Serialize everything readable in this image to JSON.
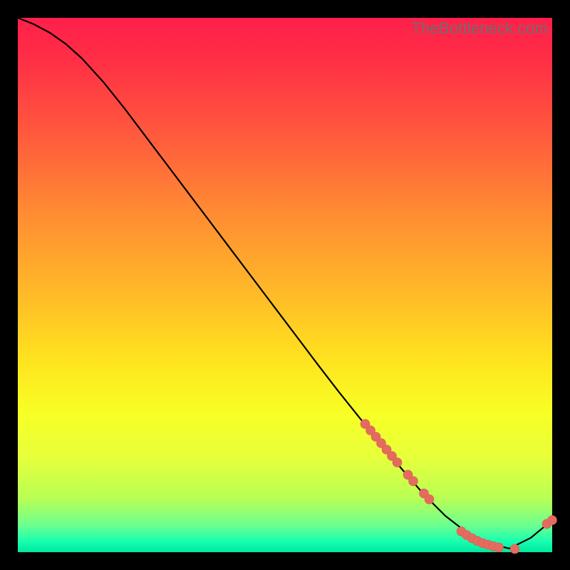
{
  "attribution": "TheBottleneck.com",
  "chart_data": {
    "type": "line",
    "title": "",
    "xlabel": "",
    "ylabel": "",
    "xlim": [
      0,
      100
    ],
    "ylim": [
      0,
      100
    ],
    "grid": false,
    "legend": false,
    "series": [
      {
        "name": "bottleneck-curve",
        "x": [
          0,
          3,
          6,
          9,
          12,
          16,
          20,
          24,
          28,
          32,
          36,
          40,
          44,
          48,
          52,
          56,
          60,
          64,
          68,
          72,
          76,
          80,
          84,
          88,
          92,
          96,
          100
        ],
        "y": [
          100,
          98.8,
          97.2,
          95.1,
          92.4,
          88.0,
          83.0,
          77.7,
          72.4,
          67.1,
          61.8,
          56.5,
          51.2,
          45.9,
          40.6,
          35.3,
          30.1,
          25.1,
          20.2,
          15.4,
          10.8,
          6.8,
          3.7,
          1.6,
          0.7,
          2.7,
          6.0
        ]
      }
    ],
    "points": {
      "name": "highlighted-samples",
      "color": "#e46b5f",
      "x": [
        65,
        66,
        67,
        68,
        69,
        70,
        71,
        73,
        74,
        76,
        77,
        83,
        84,
        85,
        86,
        87,
        88,
        89,
        90,
        93,
        99,
        100
      ],
      "y": [
        24,
        22.8,
        21.6,
        20.4,
        19.2,
        18.0,
        16.8,
        14.5,
        13.3,
        11.0,
        9.9,
        3.9,
        3.2,
        2.6,
        2.1,
        1.7,
        1.4,
        1.1,
        0.9,
        0.6,
        5.3,
        6.0
      ]
    }
  }
}
